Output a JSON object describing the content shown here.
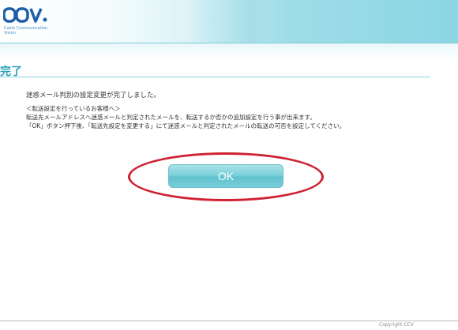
{
  "header": {
    "logo_text": "CCV",
    "logo_subtitle": "Cable Communication Vision"
  },
  "main": {
    "title": "完了",
    "message": "迷惑メール判別の設定変更が完了しました。",
    "note_heading": "＜転送設定を行っているお客様へ＞",
    "note_line1": "転送先メールアドレスへ迷惑メールと判定されたメールを、転送するか否かの追加設定を行う事が出来ます。",
    "note_line2": "「OK」ボタン押下後、「転送先設定を変更する」にて迷惑メールと判定されたメールの転送の可否を設定してください。",
    "ok_label": "OK"
  },
  "footer": {
    "text": "Copyright CCV"
  },
  "colors": {
    "accent": "#28a0b4",
    "button": "#7fd1da",
    "highlight": "#cf2233"
  }
}
